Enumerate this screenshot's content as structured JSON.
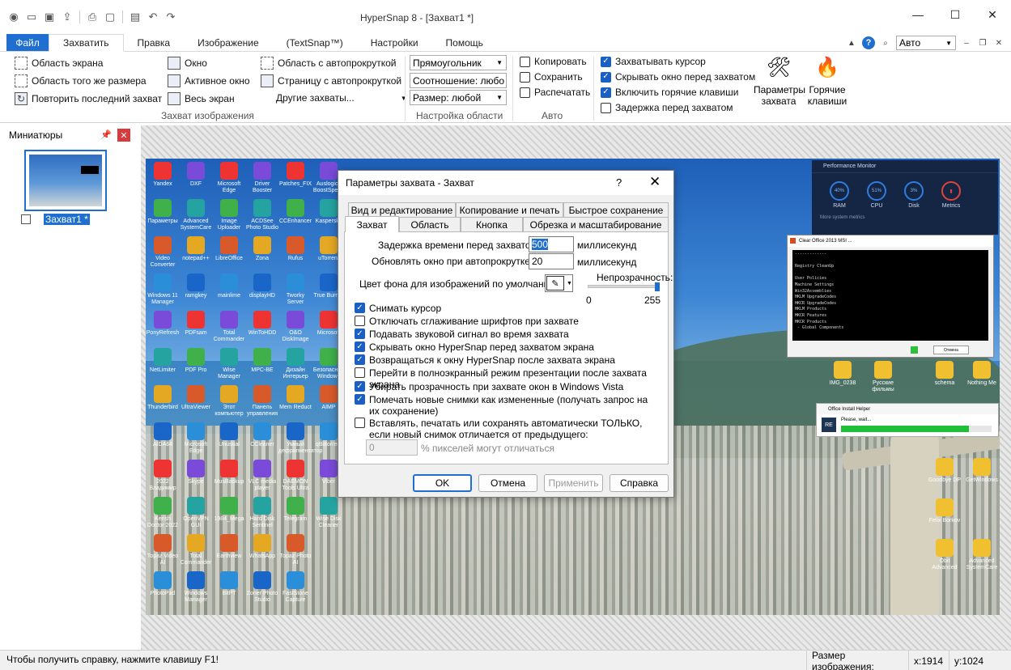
{
  "window": {
    "title": "HyperSnap 8 - [Захват1 *]",
    "controls": [
      "minimize",
      "maximize",
      "close"
    ]
  },
  "quick_access": [
    "app-icon",
    "open-icon",
    "save-icon",
    "upload-icon",
    "print-icon",
    "capture-icon",
    "undo-icon",
    "redo-icon"
  ],
  "tabs": [
    {
      "label": "Файл"
    },
    {
      "label": "Захватить"
    },
    {
      "label": "Правка"
    },
    {
      "label": "Изображение"
    },
    {
      "label": "(TextSnap™)"
    },
    {
      "label": "Настройки"
    },
    {
      "label": "Помощь"
    }
  ],
  "zoom": {
    "value": "Авто"
  },
  "ribbon": {
    "capture_col1": [
      "Область экрана",
      "Область того же размера",
      "Повторить последний захват"
    ],
    "capture_col2": [
      "Окно",
      "Активное окно",
      "Весь экран"
    ],
    "capture_col3": [
      "Область с автопрокруткой",
      "Страницу с автопрокруткой",
      "Другие захваты..."
    ],
    "group_capture": "Захват изображения",
    "region_combos": [
      "Прямоугольник",
      "Соотношение: любо",
      "Размер: любой"
    ],
    "group_region": "Настройка области",
    "auto_checks": [
      {
        "label": "Копировать",
        "checked": false
      },
      {
        "label": "Сохранить",
        "checked": false
      },
      {
        "label": "Распечатать",
        "checked": false
      }
    ],
    "group_auto": "Авто",
    "option_checks": [
      {
        "label": "Захватывать курсор",
        "checked": true
      },
      {
        "label": "Скрывать окно перед захватом",
        "checked": true
      },
      {
        "label": "Включить горячие клавиши",
        "checked": true
      },
      {
        "label": "Задержка перед захватом",
        "checked": false
      }
    ],
    "big_params": "Параметры захвата",
    "big_hotkeys": "Горячие клавиши"
  },
  "thumbnails": {
    "title": "Миниатюры",
    "items": [
      {
        "label": "Захват1 *"
      }
    ]
  },
  "dialog": {
    "title": "Параметры захвата - Захват",
    "help": "?",
    "tabs_row1": [
      "Вид и редактирование",
      "Копирование и печать",
      "Быстрое сохранение"
    ],
    "tabs_row2": [
      "Захват",
      "Область",
      "Кнопка",
      "Обрезка и масштабирование"
    ],
    "delay_label": "Задержка времени перед захватом:",
    "delay_value": "500",
    "delay_unit": "миллисекунд",
    "refresh_label": "Обновлять окно при автопрокрутке",
    "refresh_value": "20",
    "refresh_unit": "миллисекунд",
    "bg_label": "Цвет фона для изображений по умолчанию:",
    "opacity_label": "Непрозрачность:",
    "opacity_min": "0",
    "opacity_max": "255",
    "opacity_value": 255,
    "checks": [
      {
        "label": "Снимать курсор",
        "checked": true
      },
      {
        "label": "Отключать сглаживание шрифтов при захвате",
        "checked": false
      },
      {
        "label": "Подавать звуковой сигнал во время захвата",
        "checked": true
      },
      {
        "label": "Скрывать окно HyperSnap перед захватом экрана",
        "checked": true
      },
      {
        "label": "Возвращаться к окну HyperSnap после захвата экрана",
        "checked": true
      },
      {
        "label": "Перейти в полноэкранный режим презентации после захвата экрана",
        "checked": false
      },
      {
        "label": "Убирать прозрачность при захвате окон в Windows Vista",
        "checked": true
      },
      {
        "label": "Помечать новые снимки как измененные (получать запрос на их сохранение)",
        "checked": true
      },
      {
        "label": "Вставлять, печатать или сохранять автоматически ТОЛЬКО, если новый снимок отличается от предыдущего:",
        "checked": false
      }
    ],
    "diff_value": "0",
    "diff_label": "% пикселей могут отличаться",
    "buttons": {
      "ok": "OK",
      "cancel": "Отмена",
      "apply": "Применить",
      "help": "Справка"
    }
  },
  "screenshot": {
    "perf_title": "Performance Monitor",
    "perf_gauges": [
      {
        "value": "40%",
        "label": "RAM"
      },
      {
        "value": "51%",
        "label": "CPU"
      },
      {
        "value": "3%",
        "label": "Disk"
      },
      {
        "value": "",
        "label": "Metrics"
      }
    ],
    "perf_more": "More system metrics",
    "clear_title": "Clear Office 2013 MSI ...",
    "clear_lines": "-------------\n\nRegistry CleanUp\n\nUser Policies\nMachine Settings\nWin32Assemblies\nHKLM UpgradeCodes\nHKCR UpgradeCodes\nHKLM Products\nHKCR Features\nHKCR Products\n - Global Components",
    "clear_button": "Отмена",
    "install_title": "Office Install Helper",
    "install_text": "Please, wait...",
    "install_progress": 0.85,
    "desktop_icons": [
      "Yandex",
      "Параметры",
      "Video Converter",
      "Windows 11 Manager",
      "PonyRefresh",
      "NetLimiter",
      "Thunderbird",
      "AIDA64",
      "2022 Владимир",
      "Kerish Doctor 2022",
      "Topaz Video AI",
      "PhotoPad",
      "DXF",
      "Advanced SystemCare",
      "notepad++",
      "ramgkey",
      "PDFsam",
      "PDF Pro",
      "UltraViewer",
      "Microsoft Edge",
      "Skype",
      "OpenVPN GUI",
      "Total Commander",
      "Windows Manager",
      "Microsoft Edge",
      "Image Uploader",
      "LibreOffice",
      "mainlime",
      "Total Commander",
      "Wise Manager",
      "Этот компьютер",
      "Unusual",
      "MusBackup",
      "1984_Mega",
      "Earthview",
      "BitPT",
      "Driver Booster",
      "ACDSee Photo Studio",
      "Zona",
      "displayHD",
      "WinToHDD",
      "MPC-BE",
      "Панель управления",
      "CCleaner",
      "VLC media player",
      "Hard Disk Sentinel",
      "WhatsApp",
      "Zoner Photo Studio",
      "Patches_FIX",
      "CCEnhancer",
      "Rufus",
      "Tworky Server",
      "O&O DiskImage",
      "Дизайн Интерьер",
      "Mem Reduct",
      "Умный дефрагментатор",
      "DAEMON Tools Ultra",
      "Telegram",
      "Topaz Photo AI",
      "FastStone Capture",
      "Auslogics BoostSpeed",
      "Kaspersky",
      "uTorrent",
      "True Burner",
      "Microsoft",
      "Безопасное Windows",
      "AIMP",
      "qBittorrent",
      "Viber",
      "Wise Disk Cleaner",
      "IMG_0238",
      "Русские фильмы",
      "schema",
      "Nothing Me",
      "Goodbye DP",
      "GetWindows",
      "Felix Borkov",
      "Obit Advanced",
      "Advanced SystemCare"
    ]
  },
  "status": {
    "help": "Чтобы получить справку, нажмите клавишу F1!",
    "size_label": "Размер изображения:",
    "x": "x:1914",
    "y": "y:1024"
  }
}
